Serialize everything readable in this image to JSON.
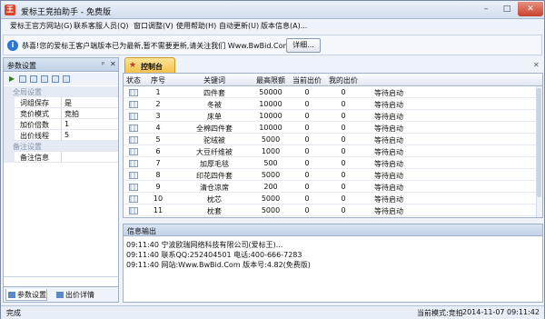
{
  "window": {
    "title": "爱标王竞拍助手 - 免费版",
    "min": "–",
    "max": "□",
    "close": "✕"
  },
  "menu": [
    "爱标王官方网站(G)",
    "联系客服人员(Q)",
    "窗口调整(V)",
    "使用帮助(H)",
    "自动更新(U)",
    "版本信息(A)..."
  ],
  "notice": {
    "text": "恭喜!您的爱标王客户端版本已为最新,暂不需要更新,请关注我们 Www.BwBid.Com",
    "detail_button": "详细..."
  },
  "left_panel": {
    "title": "参数设置",
    "pin": "ᵖ",
    "close": "✕",
    "categories": {
      "global": "全局设置",
      "note": "备注设置"
    },
    "props": [
      {
        "key": "词组保存",
        "value": "是"
      },
      {
        "key": "竞价模式",
        "value": "竞拍"
      },
      {
        "key": "加价倍数",
        "value": "1"
      },
      {
        "key": "出价线程",
        "value": "5"
      }
    ],
    "note_prop": {
      "key": "备注信息",
      "value": ""
    },
    "tabs": {
      "params": "参数设置",
      "bids": "出价详情"
    }
  },
  "console_tab": {
    "label": "控制台",
    "close": "✕"
  },
  "grid": {
    "headers": [
      "状态",
      "序号",
      "关键词",
      "最高限额",
      "当前出价",
      "我的出价",
      ""
    ],
    "rows": [
      {
        "no": "1",
        "keyword": "四件套",
        "limit": "50000",
        "current": "0",
        "mine": "0",
        "status": "等待启动"
      },
      {
        "no": "2",
        "keyword": "冬被",
        "limit": "10000",
        "current": "0",
        "mine": "0",
        "status": "等待启动"
      },
      {
        "no": "3",
        "keyword": "床单",
        "limit": "10000",
        "current": "0",
        "mine": "0",
        "status": "等待启动"
      },
      {
        "no": "4",
        "keyword": "全棉四件套",
        "limit": "10000",
        "current": "0",
        "mine": "0",
        "status": "等待启动"
      },
      {
        "no": "5",
        "keyword": "驼绒被",
        "limit": "5000",
        "current": "0",
        "mine": "0",
        "status": "等待启动"
      },
      {
        "no": "6",
        "keyword": "大豆纤维被",
        "limit": "1000",
        "current": "0",
        "mine": "0",
        "status": "等待启动"
      },
      {
        "no": "7",
        "keyword": "加厚毛毯",
        "limit": "500",
        "current": "0",
        "mine": "0",
        "status": "等待启动"
      },
      {
        "no": "8",
        "keyword": "印花四件套",
        "limit": "5000",
        "current": "0",
        "mine": "0",
        "status": "等待启动"
      },
      {
        "no": "9",
        "keyword": "清仓凉席",
        "limit": "200",
        "current": "0",
        "mine": "0",
        "status": "等待启动"
      },
      {
        "no": "10",
        "keyword": "枕芯",
        "limit": "5000",
        "current": "0",
        "mine": "0",
        "status": "等待启动"
      },
      {
        "no": "11",
        "keyword": "枕套",
        "limit": "5000",
        "current": "0",
        "mine": "0",
        "status": "等待启动"
      }
    ]
  },
  "info": {
    "title": "信息输出",
    "logs": [
      "09:11:40 宁波欧瑞网络科技有限公司(爱标王)...",
      "09:11:40 联系QQ:252404501 电话:400-666-7283",
      "09:11:40 网站:Www.BwBid.Com 版本号:4.82(免费版)"
    ]
  },
  "statusbar": {
    "left": "完成",
    "mode": "当前模式:竞拍",
    "time": "2014-11-07  09:11:42"
  }
}
